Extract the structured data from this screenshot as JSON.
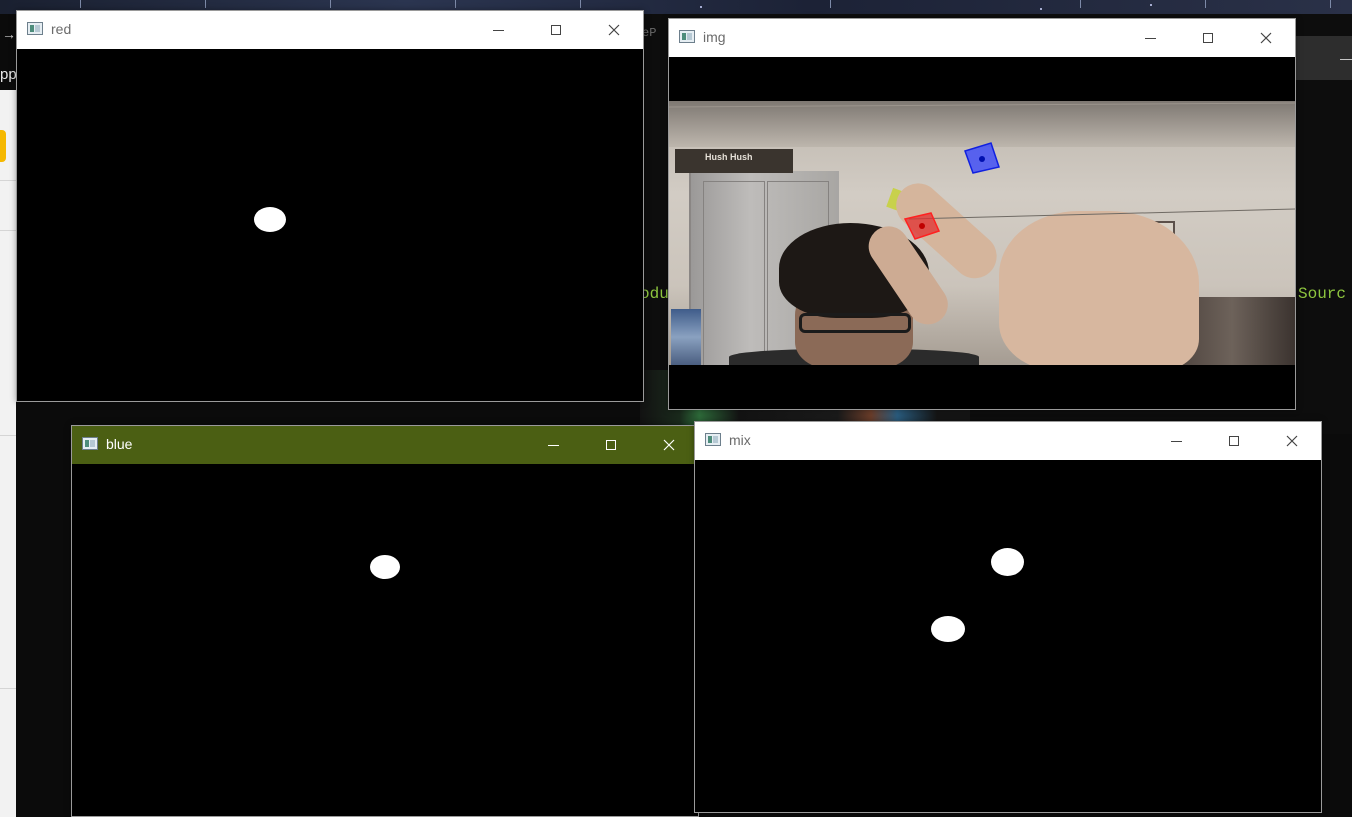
{
  "windows": {
    "red": {
      "title": "red"
    },
    "img": {
      "title": "img"
    },
    "blue": {
      "title": "blue"
    },
    "mix": {
      "title": "mix"
    }
  },
  "window_controls": {
    "minimize_icon": "minimize-icon",
    "maximize_icon": "maximize-icon",
    "close_icon": "close-icon"
  },
  "webcam": {
    "box_label": "Hush Hush"
  },
  "background": {
    "left_app_text": "pp",
    "code_fragment_left": "odu",
    "code_fragment_right": "Sourc",
    "code_fragment_top": "eP"
  },
  "colors": {
    "active_titlebar": "#4b5f13",
    "inactive_titlebar": "#ffffff",
    "mask_background": "#000000",
    "mask_blob": "#ffffff",
    "code_green": "#8ec63f",
    "red_marker": "#e0101a",
    "blue_marker": "#1020e0"
  }
}
